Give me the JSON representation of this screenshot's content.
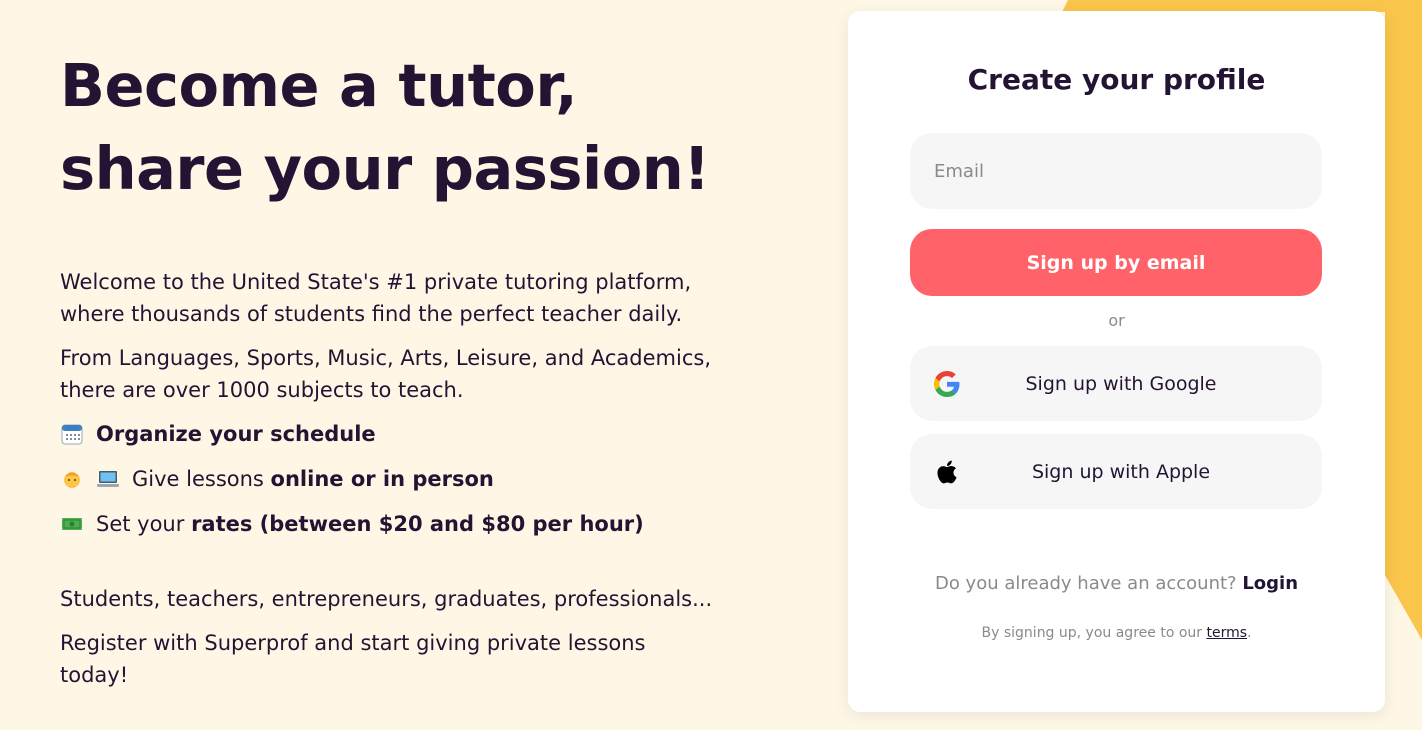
{
  "colors": {
    "background": "#fef7e6",
    "accent_yellow": "#f9c54b",
    "primary_button": "#ff6268",
    "headline": "#231433"
  },
  "hero": {
    "headline_line1": "Become a tutor,",
    "headline_line2": "share your passion!",
    "intro_line1": "Welcome to the United State's #1 private tutoring platform,",
    "intro_line2": "where thousands of students find the perfect teacher daily.",
    "subjects_line1": "From Languages, Sports, Music, Arts, Leisure, and Academics,",
    "subjects_line2": "there are over 1000 subjects to teach.",
    "features": [
      {
        "icon": "calendar-icon",
        "prefix": "",
        "bold": "Organize your schedule"
      },
      {
        "icon": "person-computer-icon",
        "prefix": "Give lessons ",
        "bold": "online or in person"
      },
      {
        "icon": "money-icon",
        "prefix": "Set your ",
        "bold": "rates (between $20 and $80 per hour)"
      }
    ],
    "audience": "Students, teachers, entrepreneurs, graduates, professionals...",
    "cta_line1": "Register with Superprof and start giving private lessons",
    "cta_line2": "today!"
  },
  "signup": {
    "title": "Create your profile",
    "email_placeholder": "Email",
    "email_value": "",
    "email_button": "Sign up by email",
    "or": "or",
    "google_button": "Sign up with Google",
    "apple_button": "Sign up with Apple",
    "have_account": "Do you already have an account?",
    "login": "Login",
    "terms_prefix": "By signing up, you agree to our ",
    "terms_link": "terms",
    "terms_suffix": "."
  }
}
